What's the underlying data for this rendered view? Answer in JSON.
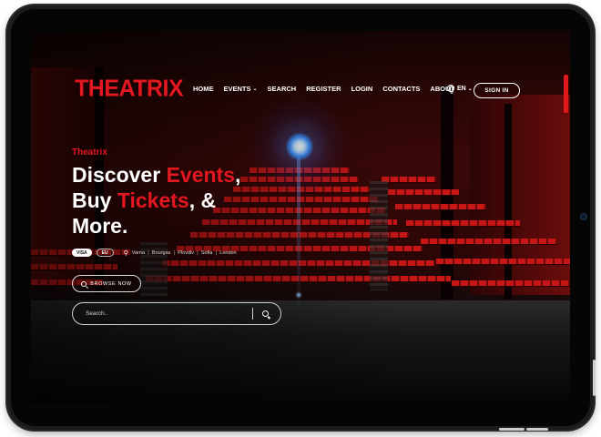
{
  "brand": {
    "logo_text": "THEATRIX",
    "accent_color": "#e3171f"
  },
  "nav": {
    "items": [
      {
        "label": "HOME"
      },
      {
        "label": "EVENTS",
        "dropdown": true
      },
      {
        "label": "SEARCH"
      },
      {
        "label": "REGISTER"
      },
      {
        "label": "LOGIN"
      },
      {
        "label": "CONTACTS"
      },
      {
        "label": "ABOUT"
      }
    ],
    "language": "EN",
    "signin_label": "SIGN IN"
  },
  "hero": {
    "eyebrow": "Theatrix",
    "headline": {
      "line1_a": "Discover ",
      "line1_b": "Events",
      "line1_c": ",",
      "line2_a": "Buy ",
      "line2_b": "Tickets",
      "line2_c": ", &",
      "line3": "More."
    },
    "chips": [
      {
        "label": "VISA",
        "active": true
      },
      {
        "label": "EU",
        "active": false
      }
    ],
    "cities": [
      "Varna",
      "Bourgas",
      "Plovdiv",
      "Sofia",
      "London"
    ],
    "browse_label": "BROWSE NOW",
    "search": {
      "placeholder": "Search..",
      "value": ""
    }
  },
  "icons": {
    "globe": "globe-icon",
    "chevron": "chevron-down-icon",
    "pin": "map-pin-icon",
    "search": "search-icon"
  }
}
